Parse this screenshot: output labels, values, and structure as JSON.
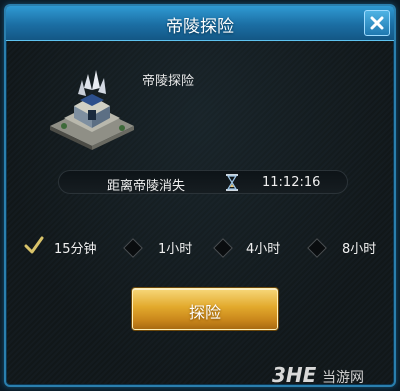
{
  "dialog": {
    "title": "帝陵探险",
    "dungeon_name": "帝陵探险",
    "timer": {
      "label": "距离帝陵消失",
      "value": "11:12:16"
    },
    "durations": [
      {
        "label": "15分钟",
        "selected": true
      },
      {
        "label": "1小时",
        "selected": false
      },
      {
        "label": "4小时",
        "selected": false
      },
      {
        "label": "8小时",
        "selected": false
      }
    ],
    "explore_label": "探险"
  },
  "watermark": {
    "logo": "3HE",
    "text": "当游网"
  },
  "colors": {
    "title_bar": "#2f9ad3",
    "button_gold": "#e2a92c",
    "check_mark": "#d9c36a"
  },
  "icons": [
    "close-icon",
    "castle-icon",
    "hourglass-icon",
    "check-icon"
  ]
}
